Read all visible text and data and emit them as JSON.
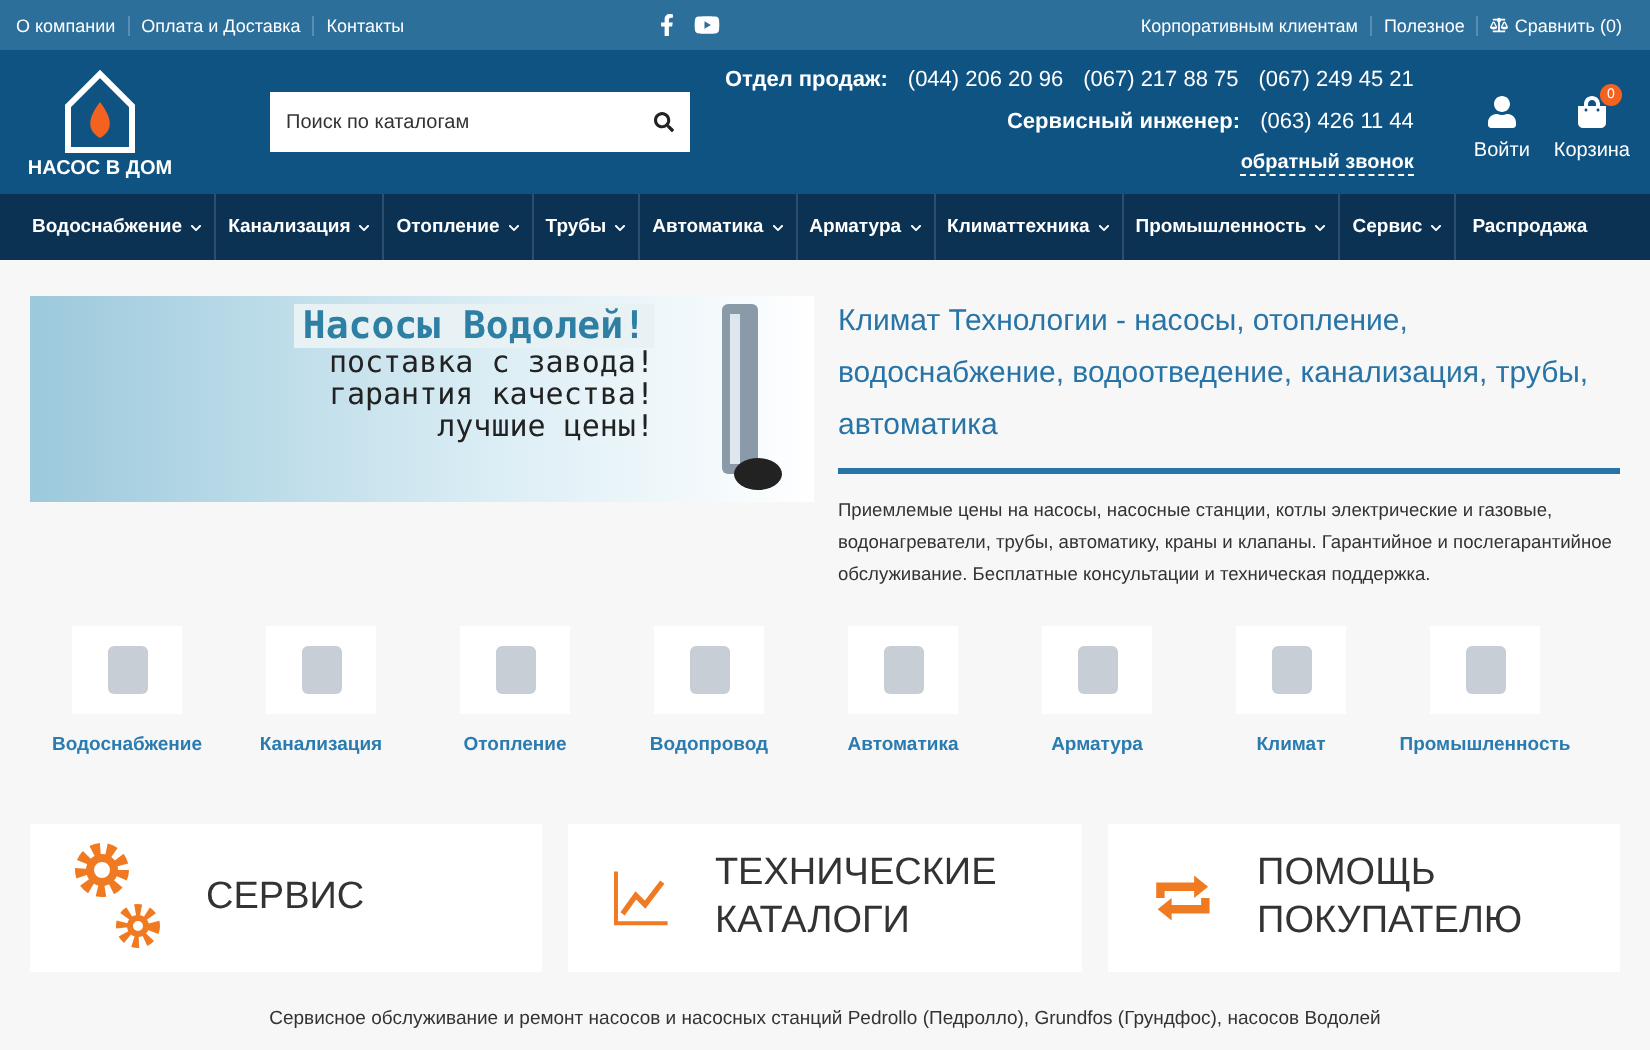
{
  "top_bar": {
    "left_links": [
      "О компании",
      "Оплата и Доставка",
      "Контакты"
    ],
    "right_links": [
      "Корпоративным клиентам",
      "Полезное"
    ],
    "compare": "Сравнить (0)"
  },
  "header": {
    "logo_text": "НАСОС В ДОМ",
    "search": {
      "placeholder": "Поиск по каталогам"
    },
    "sales_label": "Отдел продаж:",
    "sales_phones": [
      "(044) 206 20 96",
      "(067) 217 88 75",
      "(067) 249 45 21"
    ],
    "engineer_label": "Сервисный инженер:",
    "engineer_phone": "(063) 426 11 44",
    "callback": "обратный звонок",
    "login": "Войти",
    "cart": "Корзина",
    "cart_count": "0"
  },
  "nav": [
    {
      "label": "Водоснабжение",
      "dropdown": true
    },
    {
      "label": "Канализация",
      "dropdown": true
    },
    {
      "label": "Отопление",
      "dropdown": true
    },
    {
      "label": "Трубы",
      "dropdown": true
    },
    {
      "label": "Автоматика",
      "dropdown": true
    },
    {
      "label": "Арматура",
      "dropdown": true
    },
    {
      "label": "Климаттехника",
      "dropdown": true
    },
    {
      "label": "Промышленность",
      "dropdown": true
    },
    {
      "label": "Сервис",
      "dropdown": true
    },
    {
      "label": "Распродажа",
      "dropdown": false
    }
  ],
  "banner": {
    "title": "Насосы Водолей!",
    "lines": [
      "поставка с завода!",
      "гарантия качества!",
      "лучшие цены!"
    ]
  },
  "intro": {
    "heading": "Климат Технологии - насосы, отопление, водоснабжение, водоотведение, канализация, трубы, автоматика",
    "text": "Приемлемые цены на насосы, насосные станции, котлы электрические и газовые, водонагреватели, трубы, автоматику, краны и клапаны. Гарантийное и послегарантийное обслуживание. Бесплатные консультации и техническая поддержка."
  },
  "categories": [
    "Водоснабжение",
    "Канализация",
    "Отопление",
    "Водопровод",
    "Автоматика",
    "Арматура",
    "Климат",
    "Промышленность"
  ],
  "feature_cards": [
    {
      "kind": "gears",
      "label": "СЕРВИС"
    },
    {
      "kind": "chart",
      "label": "ТЕХНИЧЕСКИЕ КАТАЛОГИ"
    },
    {
      "kind": "arrows",
      "label": "ПОМОЩЬ ПОКУПАТЕЛЮ"
    }
  ],
  "footer_text": "Сервисное обслуживание и ремонт насосов и насосных станций Pedrollo (Педролло), Grundfos (Грундфос), насосов Водолей"
}
